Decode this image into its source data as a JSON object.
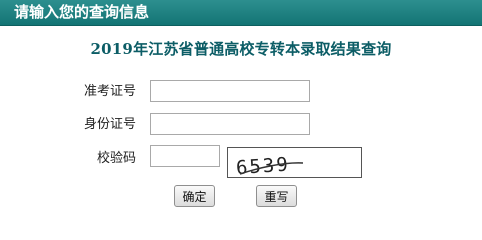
{
  "header": {
    "title": "请输入您的查询信息"
  },
  "form": {
    "heading": "2019年江苏省普通高校专转本录取结果查询",
    "fields": {
      "exam_no": {
        "label": "准考证号",
        "value": ""
      },
      "id_no": {
        "label": "身份证号",
        "value": ""
      },
      "captcha": {
        "label": "校验码",
        "value": "",
        "image_text": "6539"
      }
    },
    "buttons": {
      "submit": "确定",
      "reset": "重写"
    }
  }
}
